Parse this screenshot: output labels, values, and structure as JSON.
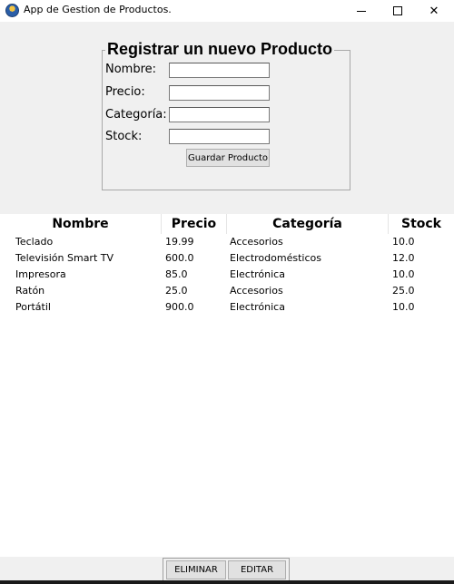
{
  "window": {
    "title": "App de Gestion de Productos.",
    "icon": "app-icon",
    "controls": [
      "minimize-icon",
      "maximize-icon",
      "close-icon"
    ],
    "close_glyph": "✕"
  },
  "form": {
    "legend": "Registrar un nuevo Producto",
    "fields": [
      {
        "label": "Nombre:",
        "value": ""
      },
      {
        "label": "Precio:",
        "value": ""
      },
      {
        "label": "Categoría:",
        "value": ""
      },
      {
        "label": "Stock:",
        "value": ""
      }
    ],
    "save_label": "Guardar Producto"
  },
  "table": {
    "columns": [
      "Nombre",
      "Precio",
      "Categoría",
      "Stock"
    ],
    "rows": [
      [
        "Teclado",
        "19.99",
        "Accesorios",
        "10.0"
      ],
      [
        "Televisión Smart TV",
        "600.0",
        "Electrodomésticos",
        "12.0"
      ],
      [
        "Impresora",
        "85.0",
        "Electrónica",
        "10.0"
      ],
      [
        "Ratón",
        "25.0",
        "Accesorios",
        "25.0"
      ],
      [
        "Portátil",
        "900.0",
        "Electrónica",
        "10.0"
      ]
    ]
  },
  "actions": {
    "delete_label": "ELIMINAR",
    "edit_label": "EDITAR"
  }
}
